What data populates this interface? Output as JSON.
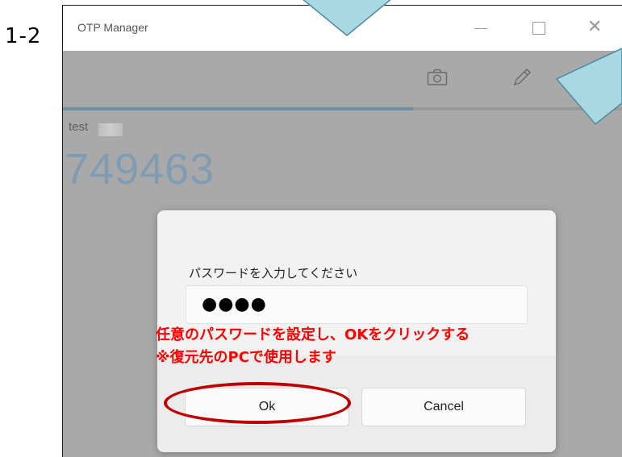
{
  "step_label": "1-2",
  "window": {
    "title": "OTP Manager",
    "controls": {
      "minimize_glyph": "—",
      "maximize_glyph": "☐",
      "close_glyph": "✕"
    }
  },
  "toolbar": {
    "icons": [
      "camera-icon",
      "pencil-icon"
    ]
  },
  "progress": {
    "fraction": 0.625,
    "fill_color": "#6e8fa6"
  },
  "account": {
    "name": "test",
    "code": "749463"
  },
  "dialog": {
    "prompt": "パスワードを入力してください",
    "password_masked": "●●●●",
    "ok_label": "Ok",
    "cancel_label": "Cancel"
  },
  "annotation": {
    "line1": "任意のパスワードを設定し、OKをクリックする",
    "line2": "※復元先のPCで使用します",
    "color": "#ff0000"
  },
  "colors": {
    "callout_fill": "#a8d8e2",
    "callout_stroke": "#4f8aa0",
    "highlight_ellipse": "#c00000"
  }
}
